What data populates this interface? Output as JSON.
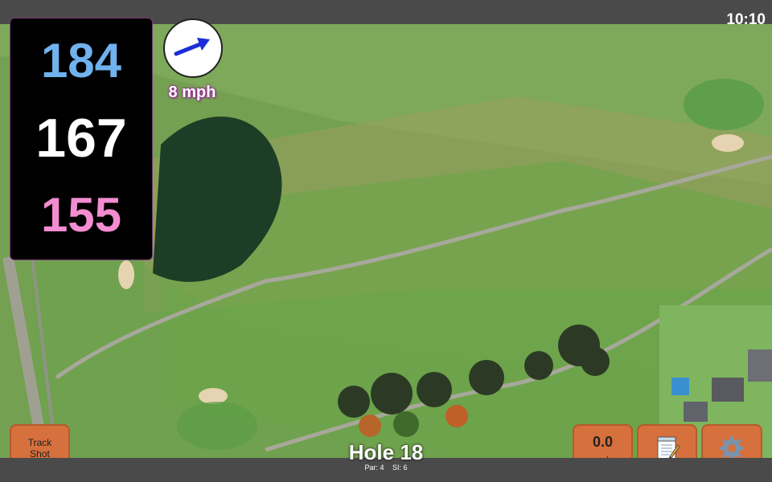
{
  "status_bar": {
    "time": "10:10"
  },
  "distances": {
    "back": "184",
    "middle": "167",
    "front": "155"
  },
  "wind": {
    "speed_label": "8 mph",
    "direction_icon": "arrow-icon"
  },
  "buttons": {
    "track_shot": "Track Shot",
    "wind_value": "0.0",
    "wind_unit": "mph",
    "notes_icon": "notepad-icon",
    "settings_icon": "gear-icon"
  },
  "hole": {
    "title": "Hole 18",
    "par": "Par: 4",
    "si": "SI: 6"
  },
  "colors": {
    "back": "#6fb2ee",
    "middle": "#ffffff",
    "front": "#f38cd0",
    "button": "#d6703c",
    "wind_arrow": "#1a2ed8"
  }
}
